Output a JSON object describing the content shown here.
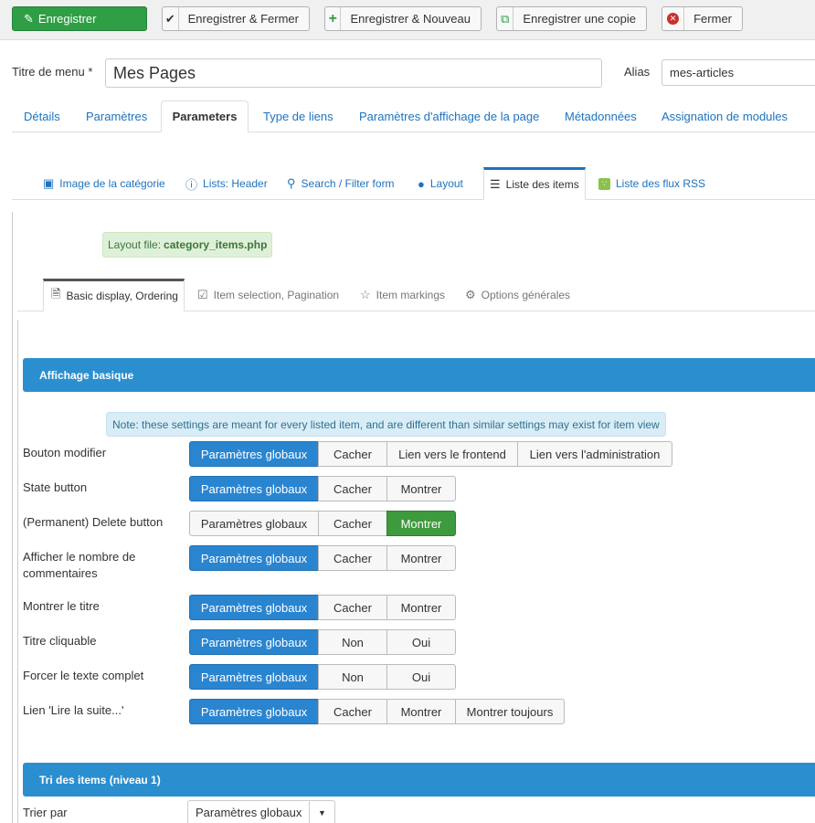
{
  "toolbar": {
    "save": "Enregistrer",
    "save_close": "Enregistrer & Fermer",
    "save_new": "Enregistrer & Nouveau",
    "save_copy": "Enregistrer une copie",
    "close": "Fermer"
  },
  "form": {
    "title_label": "Titre de menu *",
    "title_value": "Mes Pages",
    "alias_label": "Alias",
    "alias_value": "mes-articles"
  },
  "main_tabs": [
    "Détails",
    "Paramètres",
    "Parameters",
    "Type de liens",
    "Paramètres d'affichage de la page",
    "Métadonnées",
    "Assignation de modules"
  ],
  "sub_tabs": [
    "Image de la catégorie",
    "Lists: Header",
    "Search / Filter form",
    "Layout",
    "Liste des items",
    "Liste des flux RSS"
  ],
  "layout_file": {
    "prefix": "Layout file:",
    "name": "category_items.php"
  },
  "inner_tabs": [
    "Basic display, Ordering",
    "Item selection, Pagination",
    "Item markings",
    "Options générales"
  ],
  "section1": "Affichage basique",
  "note": "Note: these settings are meant for every listed item, and are different than similar settings may exist for item view",
  "rows": [
    {
      "label": "Bouton modifier",
      "options": [
        "Paramètres globaux",
        "Cacher",
        "Lien vers le frontend",
        "Lien vers l'administration"
      ],
      "selected": 0
    },
    {
      "label": "State button",
      "options": [
        "Paramètres globaux",
        "Cacher",
        "Montrer"
      ],
      "selected": 0
    },
    {
      "label": "(Permanent) Delete button",
      "options": [
        "Paramètres globaux",
        "Cacher",
        "Montrer"
      ],
      "selected": 2
    },
    {
      "label": "Afficher le nombre de commentaires",
      "options": [
        "Paramètres globaux",
        "Cacher",
        "Montrer"
      ],
      "selected": 0
    },
    {
      "label": "Montrer le titre",
      "options": [
        "Paramètres globaux",
        "Cacher",
        "Montrer"
      ],
      "selected": 0
    },
    {
      "label": "Titre cliquable",
      "options": [
        "Paramètres globaux",
        "Non",
        "Oui"
      ],
      "selected": 0
    },
    {
      "label": "Forcer le texte complet",
      "options": [
        "Paramètres globaux",
        "Non",
        "Oui"
      ],
      "selected": 0
    },
    {
      "label": "Lien 'Lire la suite...'",
      "options": [
        "Paramètres globaux",
        "Cacher",
        "Montrer",
        "Montrer toujours"
      ],
      "selected": 0
    }
  ],
  "section2": "Tri des items (niveau 1)",
  "sort": {
    "label": "Trier par",
    "value": "Paramètres globaux"
  }
}
